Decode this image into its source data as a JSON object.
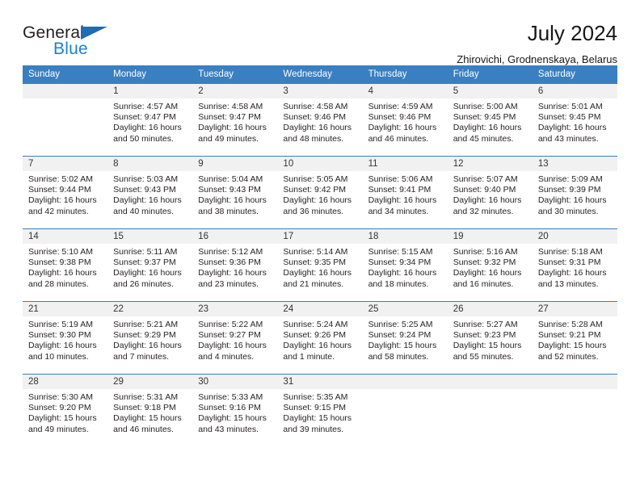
{
  "brand": {
    "name_part1": "General",
    "name_part2": "Blue",
    "triangle_color": "#1f6cb0",
    "blue_color": "#1f7fd0"
  },
  "header": {
    "title": "July 2024",
    "subtitle": "Zhirovichi, Grodnenskaya, Belarus",
    "header_bg": "#3a7fc1",
    "daynum_bg": "#f1f1f1"
  },
  "weekday_headers": [
    "Sunday",
    "Monday",
    "Tuesday",
    "Wednesday",
    "Thursday",
    "Friday",
    "Saturday"
  ],
  "weeks": [
    [
      {
        "day": "",
        "sunrise": "",
        "sunset": "",
        "daylight1": "",
        "daylight2": ""
      },
      {
        "day": "1",
        "sunrise": "Sunrise: 4:57 AM",
        "sunset": "Sunset: 9:47 PM",
        "daylight1": "Daylight: 16 hours",
        "daylight2": "and 50 minutes."
      },
      {
        "day": "2",
        "sunrise": "Sunrise: 4:58 AM",
        "sunset": "Sunset: 9:47 PM",
        "daylight1": "Daylight: 16 hours",
        "daylight2": "and 49 minutes."
      },
      {
        "day": "3",
        "sunrise": "Sunrise: 4:58 AM",
        "sunset": "Sunset: 9:46 PM",
        "daylight1": "Daylight: 16 hours",
        "daylight2": "and 48 minutes."
      },
      {
        "day": "4",
        "sunrise": "Sunrise: 4:59 AM",
        "sunset": "Sunset: 9:46 PM",
        "daylight1": "Daylight: 16 hours",
        "daylight2": "and 46 minutes."
      },
      {
        "day": "5",
        "sunrise": "Sunrise: 5:00 AM",
        "sunset": "Sunset: 9:45 PM",
        "daylight1": "Daylight: 16 hours",
        "daylight2": "and 45 minutes."
      },
      {
        "day": "6",
        "sunrise": "Sunrise: 5:01 AM",
        "sunset": "Sunset: 9:45 PM",
        "daylight1": "Daylight: 16 hours",
        "daylight2": "and 43 minutes."
      }
    ],
    [
      {
        "day": "7",
        "sunrise": "Sunrise: 5:02 AM",
        "sunset": "Sunset: 9:44 PM",
        "daylight1": "Daylight: 16 hours",
        "daylight2": "and 42 minutes."
      },
      {
        "day": "8",
        "sunrise": "Sunrise: 5:03 AM",
        "sunset": "Sunset: 9:43 PM",
        "daylight1": "Daylight: 16 hours",
        "daylight2": "and 40 minutes."
      },
      {
        "day": "9",
        "sunrise": "Sunrise: 5:04 AM",
        "sunset": "Sunset: 9:43 PM",
        "daylight1": "Daylight: 16 hours",
        "daylight2": "and 38 minutes."
      },
      {
        "day": "10",
        "sunrise": "Sunrise: 5:05 AM",
        "sunset": "Sunset: 9:42 PM",
        "daylight1": "Daylight: 16 hours",
        "daylight2": "and 36 minutes."
      },
      {
        "day": "11",
        "sunrise": "Sunrise: 5:06 AM",
        "sunset": "Sunset: 9:41 PM",
        "daylight1": "Daylight: 16 hours",
        "daylight2": "and 34 minutes."
      },
      {
        "day": "12",
        "sunrise": "Sunrise: 5:07 AM",
        "sunset": "Sunset: 9:40 PM",
        "daylight1": "Daylight: 16 hours",
        "daylight2": "and 32 minutes."
      },
      {
        "day": "13",
        "sunrise": "Sunrise: 5:09 AM",
        "sunset": "Sunset: 9:39 PM",
        "daylight1": "Daylight: 16 hours",
        "daylight2": "and 30 minutes."
      }
    ],
    [
      {
        "day": "14",
        "sunrise": "Sunrise: 5:10 AM",
        "sunset": "Sunset: 9:38 PM",
        "daylight1": "Daylight: 16 hours",
        "daylight2": "and 28 minutes."
      },
      {
        "day": "15",
        "sunrise": "Sunrise: 5:11 AM",
        "sunset": "Sunset: 9:37 PM",
        "daylight1": "Daylight: 16 hours",
        "daylight2": "and 26 minutes."
      },
      {
        "day": "16",
        "sunrise": "Sunrise: 5:12 AM",
        "sunset": "Sunset: 9:36 PM",
        "daylight1": "Daylight: 16 hours",
        "daylight2": "and 23 minutes."
      },
      {
        "day": "17",
        "sunrise": "Sunrise: 5:14 AM",
        "sunset": "Sunset: 9:35 PM",
        "daylight1": "Daylight: 16 hours",
        "daylight2": "and 21 minutes."
      },
      {
        "day": "18",
        "sunrise": "Sunrise: 5:15 AM",
        "sunset": "Sunset: 9:34 PM",
        "daylight1": "Daylight: 16 hours",
        "daylight2": "and 18 minutes."
      },
      {
        "day": "19",
        "sunrise": "Sunrise: 5:16 AM",
        "sunset": "Sunset: 9:32 PM",
        "daylight1": "Daylight: 16 hours",
        "daylight2": "and 16 minutes."
      },
      {
        "day": "20",
        "sunrise": "Sunrise: 5:18 AM",
        "sunset": "Sunset: 9:31 PM",
        "daylight1": "Daylight: 16 hours",
        "daylight2": "and 13 minutes."
      }
    ],
    [
      {
        "day": "21",
        "sunrise": "Sunrise: 5:19 AM",
        "sunset": "Sunset: 9:30 PM",
        "daylight1": "Daylight: 16 hours",
        "daylight2": "and 10 minutes."
      },
      {
        "day": "22",
        "sunrise": "Sunrise: 5:21 AM",
        "sunset": "Sunset: 9:29 PM",
        "daylight1": "Daylight: 16 hours",
        "daylight2": "and 7 minutes."
      },
      {
        "day": "23",
        "sunrise": "Sunrise: 5:22 AM",
        "sunset": "Sunset: 9:27 PM",
        "daylight1": "Daylight: 16 hours",
        "daylight2": "and 4 minutes."
      },
      {
        "day": "24",
        "sunrise": "Sunrise: 5:24 AM",
        "sunset": "Sunset: 9:26 PM",
        "daylight1": "Daylight: 16 hours",
        "daylight2": "and 1 minute."
      },
      {
        "day": "25",
        "sunrise": "Sunrise: 5:25 AM",
        "sunset": "Sunset: 9:24 PM",
        "daylight1": "Daylight: 15 hours",
        "daylight2": "and 58 minutes."
      },
      {
        "day": "26",
        "sunrise": "Sunrise: 5:27 AM",
        "sunset": "Sunset: 9:23 PM",
        "daylight1": "Daylight: 15 hours",
        "daylight2": "and 55 minutes."
      },
      {
        "day": "27",
        "sunrise": "Sunrise: 5:28 AM",
        "sunset": "Sunset: 9:21 PM",
        "daylight1": "Daylight: 15 hours",
        "daylight2": "and 52 minutes."
      }
    ],
    [
      {
        "day": "28",
        "sunrise": "Sunrise: 5:30 AM",
        "sunset": "Sunset: 9:20 PM",
        "daylight1": "Daylight: 15 hours",
        "daylight2": "and 49 minutes."
      },
      {
        "day": "29",
        "sunrise": "Sunrise: 5:31 AM",
        "sunset": "Sunset: 9:18 PM",
        "daylight1": "Daylight: 15 hours",
        "daylight2": "and 46 minutes."
      },
      {
        "day": "30",
        "sunrise": "Sunrise: 5:33 AM",
        "sunset": "Sunset: 9:16 PM",
        "daylight1": "Daylight: 15 hours",
        "daylight2": "and 43 minutes."
      },
      {
        "day": "31",
        "sunrise": "Sunrise: 5:35 AM",
        "sunset": "Sunset: 9:15 PM",
        "daylight1": "Daylight: 15 hours",
        "daylight2": "and 39 minutes."
      },
      {
        "day": "",
        "sunrise": "",
        "sunset": "",
        "daylight1": "",
        "daylight2": ""
      },
      {
        "day": "",
        "sunrise": "",
        "sunset": "",
        "daylight1": "",
        "daylight2": ""
      },
      {
        "day": "",
        "sunrise": "",
        "sunset": "",
        "daylight1": "",
        "daylight2": ""
      }
    ]
  ]
}
